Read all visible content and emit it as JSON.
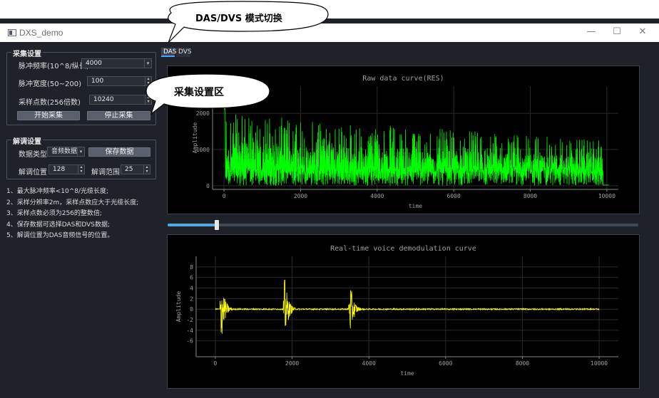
{
  "window": {
    "title": "DXS_demo",
    "minimize": "—",
    "maximize": "☐",
    "close": "✕"
  },
  "callouts": {
    "mode_switch": "DAS/DVS 模式切换",
    "acquisition_area": "采集设置区"
  },
  "acquisition": {
    "group_title": "采集设置",
    "pulse_rate_label": "脉冲频率(10^8/纵长)",
    "pulse_rate_value": "4000",
    "pulse_width_label": "脉冲宽度(50~200)",
    "pulse_width_value": "100",
    "sample_points_label": "采样点数(256倍数)",
    "sample_points_value": "10240",
    "start_button": "开始采集",
    "stop_button": "停止采集"
  },
  "demodulation": {
    "group_title": "解调设置",
    "data_type_label": "数据类型",
    "data_type_value": "音频数据",
    "save_button": "保存数据",
    "position_label": "解调位置",
    "position_value": "128",
    "range_label": "解调范围",
    "range_value": "25"
  },
  "notes": [
    "1、最大脉冲频率<10^8/光缆长度;",
    "2、采样分辨率2m，采样点数应大于光缆长度;",
    "3、采样点数必须为256的整数倍;",
    "4、保存数据可选择DAS和DVS数据;",
    "5、解调位置为DAS音频信号的位置。"
  ],
  "tabs": [
    {
      "label": "DAS",
      "active": true
    },
    {
      "label": "DVS",
      "active": false
    }
  ],
  "slider": {
    "value_fraction": 0.105
  },
  "chart_data": [
    {
      "type": "line",
      "title": "Raw data curve(RES)",
      "xlabel": "time",
      "ylabel": "Amplitude",
      "xlim": [
        -300,
        10300
      ],
      "ylim": [
        -100,
        2750
      ],
      "x_ticks": [
        0,
        2000,
        4000,
        6000,
        8000,
        10000
      ],
      "y_ticks": [
        0,
        1000,
        2000
      ],
      "series": [
        {
          "color": "#00ff00",
          "x_range": [
            0,
            9900
          ],
          "baseline": 600,
          "peak_start": 2000,
          "peak_end": 1250
        }
      ],
      "grid": true
    },
    {
      "type": "line",
      "title": "Real-time voice demodulation curve",
      "xlabel": "time",
      "ylabel": "Amplitude",
      "xlim": [
        -500,
        10500
      ],
      "ylim": [
        -9,
        10
      ],
      "x_ticks": [
        0,
        2000,
        4000,
        6000,
        8000,
        10000
      ],
      "y_ticks": [
        -6,
        -4,
        -2,
        0,
        2,
        4,
        6,
        8
      ],
      "series": [
        {
          "color": "#ffff00",
          "x_range": [
            0,
            10000
          ],
          "bursts": [
            {
              "x": 150,
              "amp": 6.5
            },
            {
              "x": 1800,
              "amp": 6.5
            },
            {
              "x": 3500,
              "amp": 6
            }
          ]
        }
      ],
      "grid": true
    }
  ]
}
